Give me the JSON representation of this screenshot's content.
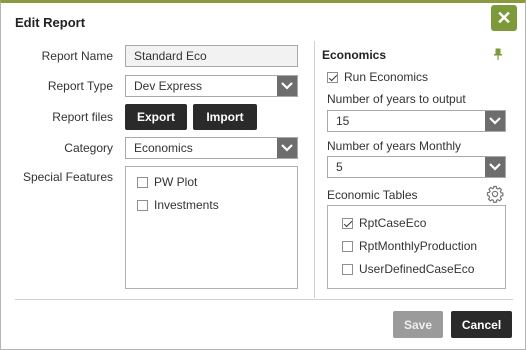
{
  "dialog": {
    "title": "Edit Report",
    "close_glyph": "✕"
  },
  "form": {
    "report_name_label": "Report Name",
    "report_name_value": "Standard Eco",
    "report_type_label": "Report Type",
    "report_type_value": "Dev Express",
    "report_files_label": "Report files",
    "export_label": "Export",
    "import_label": "Import",
    "category_label": "Category",
    "category_value": "Economics",
    "special_features_label": "Special Features",
    "special_features": [
      {
        "label": "PW Plot",
        "checked": false
      },
      {
        "label": "Investments",
        "checked": false
      }
    ]
  },
  "economics": {
    "section_title": "Economics",
    "run_economics_label": "Run Economics",
    "run_economics_checked": true,
    "years_output_label": "Number of years to output",
    "years_output_value": "15",
    "years_monthly_label": "Number of years Monthly",
    "years_monthly_value": "5",
    "tables_label": "Economic Tables",
    "tables": [
      {
        "label": "RptCaseEco",
        "checked": true
      },
      {
        "label": "RptMonthlyProduction",
        "checked": false
      },
      {
        "label": "UserDefinedCaseEco",
        "checked": false
      }
    ]
  },
  "footer": {
    "save_label": "Save",
    "cancel_label": "Cancel"
  },
  "colors": {
    "accent": "#7c9a3a",
    "dark_button": "#2a2a2a",
    "disabled_button": "#9b9b9b"
  },
  "icons": {
    "close": "close-icon",
    "pin": "pin-icon",
    "settings": "gear-icon",
    "dropdown": "chevron-down-icon"
  }
}
